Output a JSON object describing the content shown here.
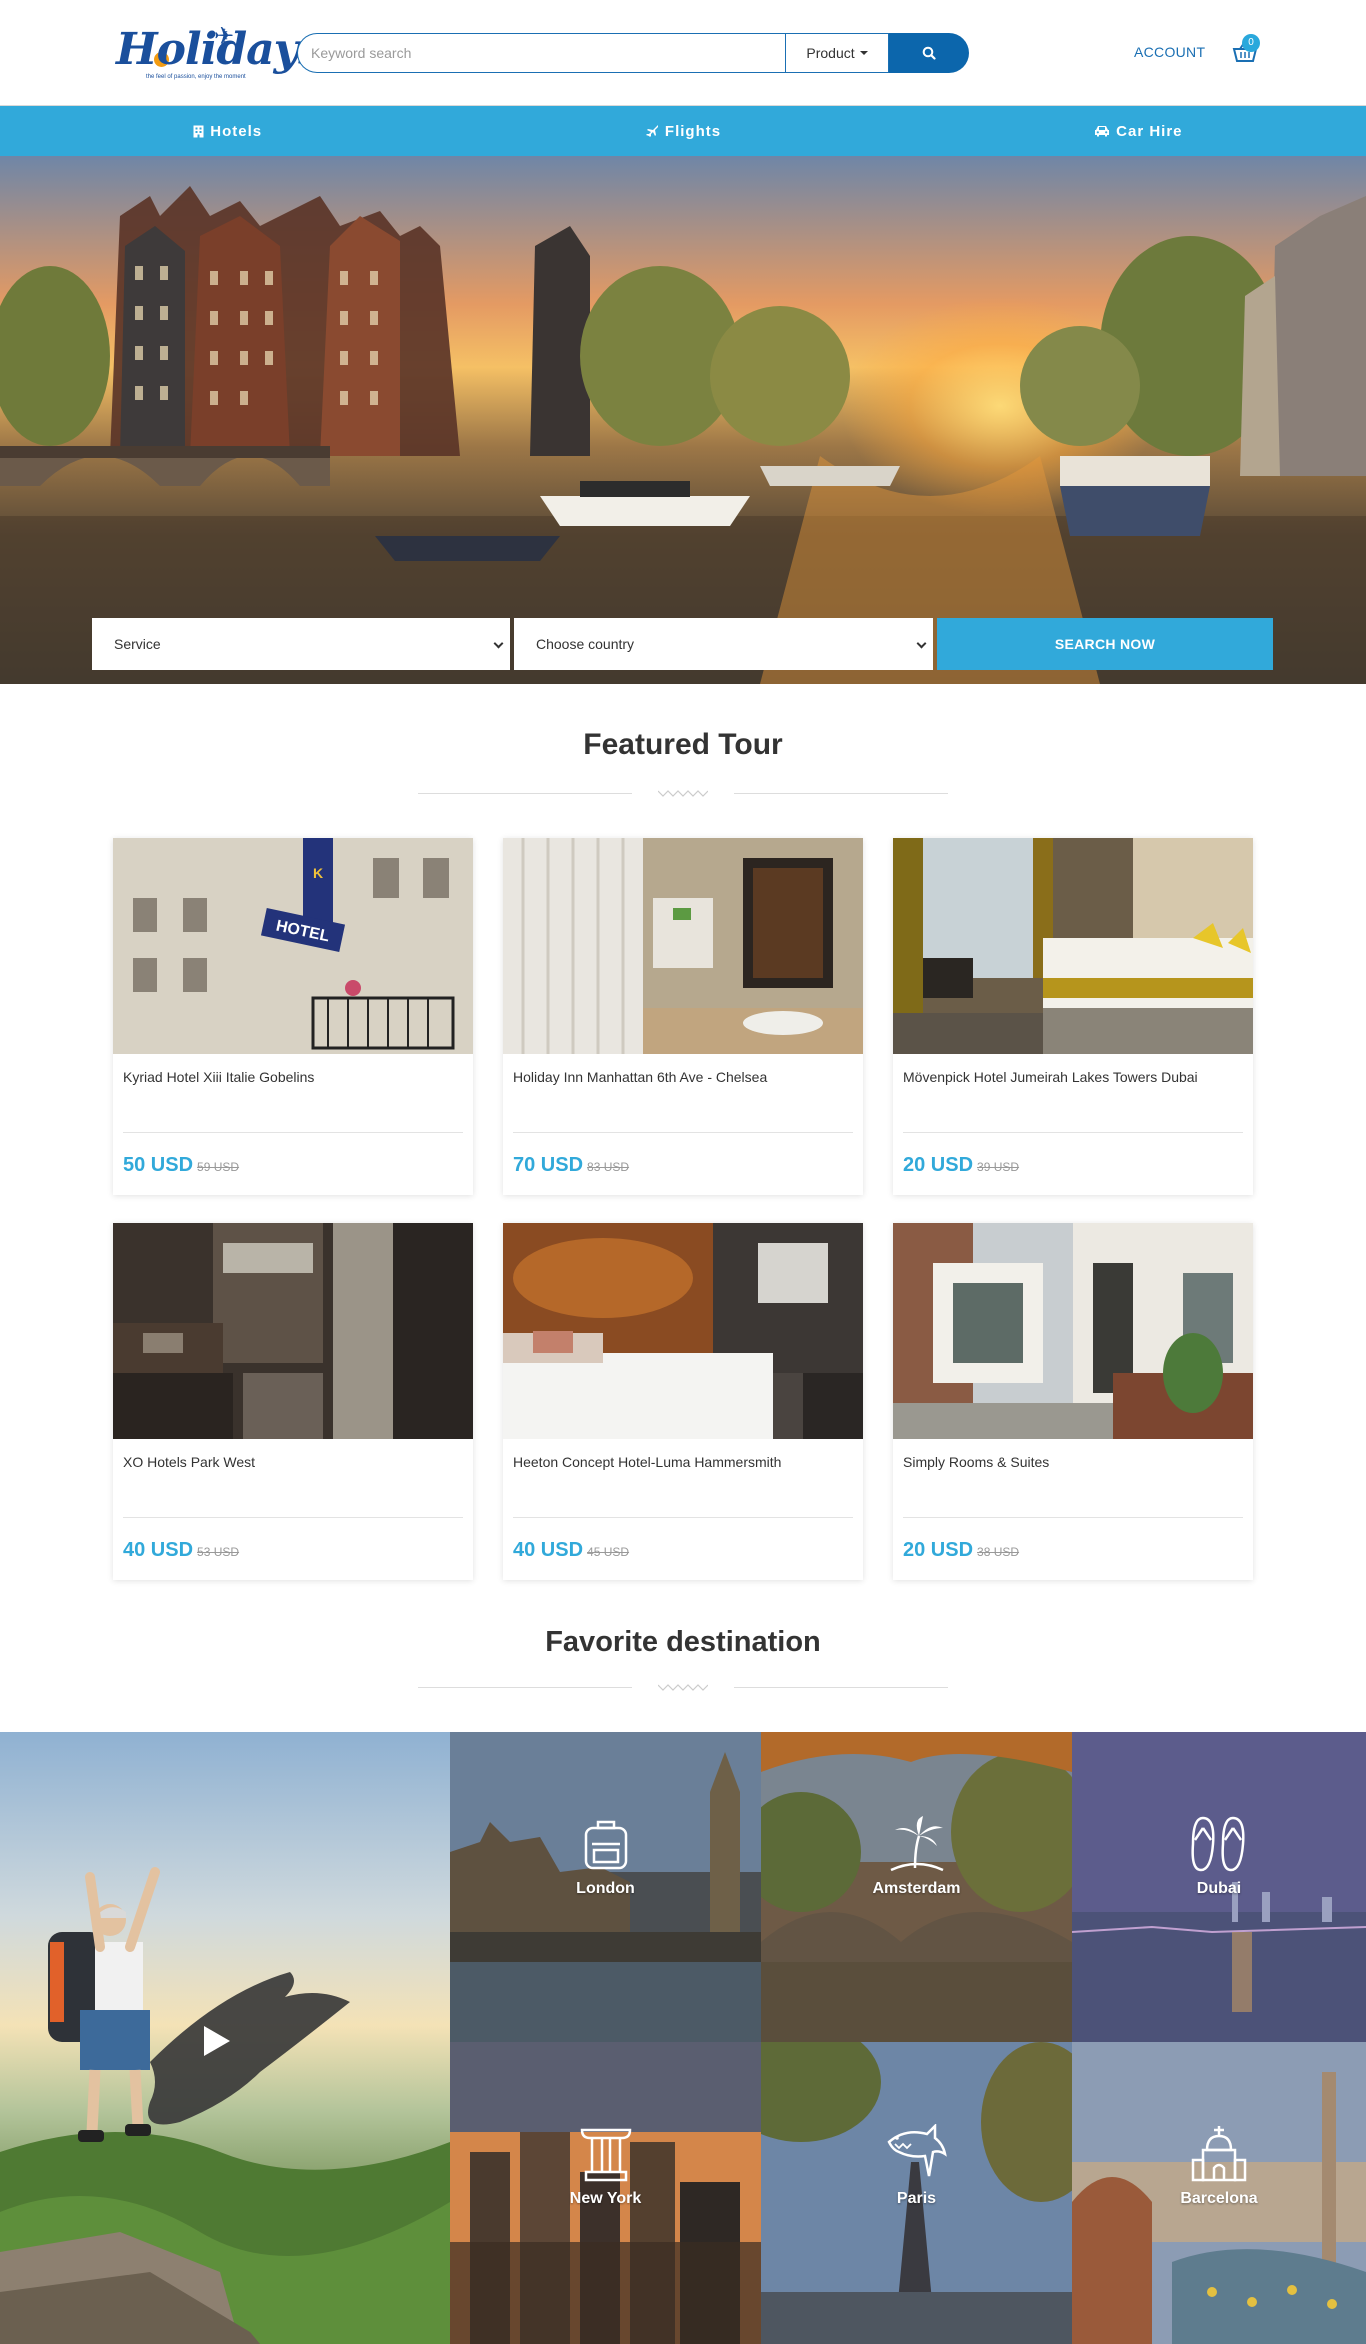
{
  "header": {
    "logo_text": "Holidays",
    "logo_tagline": "the feel of passion, enjoy the moment",
    "search_placeholder": "Keyword search",
    "product_label": "Product",
    "account_label": "ACCOUNT",
    "cart_count": "0"
  },
  "nav": [
    {
      "label": "Hotels",
      "icon": "building-icon"
    },
    {
      "label": "Flights",
      "icon": "plane-icon"
    },
    {
      "label": "Car Hire",
      "icon": "car-icon"
    }
  ],
  "hero_search": {
    "service_value": "Service",
    "country_value": "Choose country",
    "button_label": "SEARCH NOW"
  },
  "featured": {
    "title": "Featured Tour",
    "cards": [
      {
        "name": "Kyriad Hotel Xiii Italie Gobelins",
        "price": "50 USD",
        "old_price": "59 USD"
      },
      {
        "name": "Holiday Inn Manhattan 6th Ave - Chelsea",
        "price": "70 USD",
        "old_price": "83 USD"
      },
      {
        "name": "Mövenpick Hotel Jumeirah Lakes Towers Dubai",
        "price": "20 USD",
        "old_price": "39 USD"
      },
      {
        "name": "XO Hotels Park West",
        "price": "40 USD",
        "old_price": "53 USD"
      },
      {
        "name": "Heeton Concept Hotel-Luma Hammersmith",
        "price": "40 USD",
        "old_price": "45 USD"
      },
      {
        "name": "Simply Rooms & Suites",
        "price": "20 USD",
        "old_price": "38 USD"
      }
    ]
  },
  "destinations": {
    "title": "Favorite destination",
    "tiles": [
      {
        "name": "London",
        "icon": "backpack-icon"
      },
      {
        "name": "Amsterdam",
        "icon": "palm-island-icon"
      },
      {
        "name": "Dubai",
        "icon": "flip-flops-icon"
      },
      {
        "name": "New York",
        "icon": "column-icon"
      },
      {
        "name": "Paris",
        "icon": "shark-icon"
      },
      {
        "name": "Barcelona",
        "icon": "church-icon"
      }
    ]
  },
  "colors": {
    "primary": "#31a9da",
    "dark_blue": "#0c66ac",
    "logo_blue": "#1a4f9c",
    "text": "#333333"
  }
}
